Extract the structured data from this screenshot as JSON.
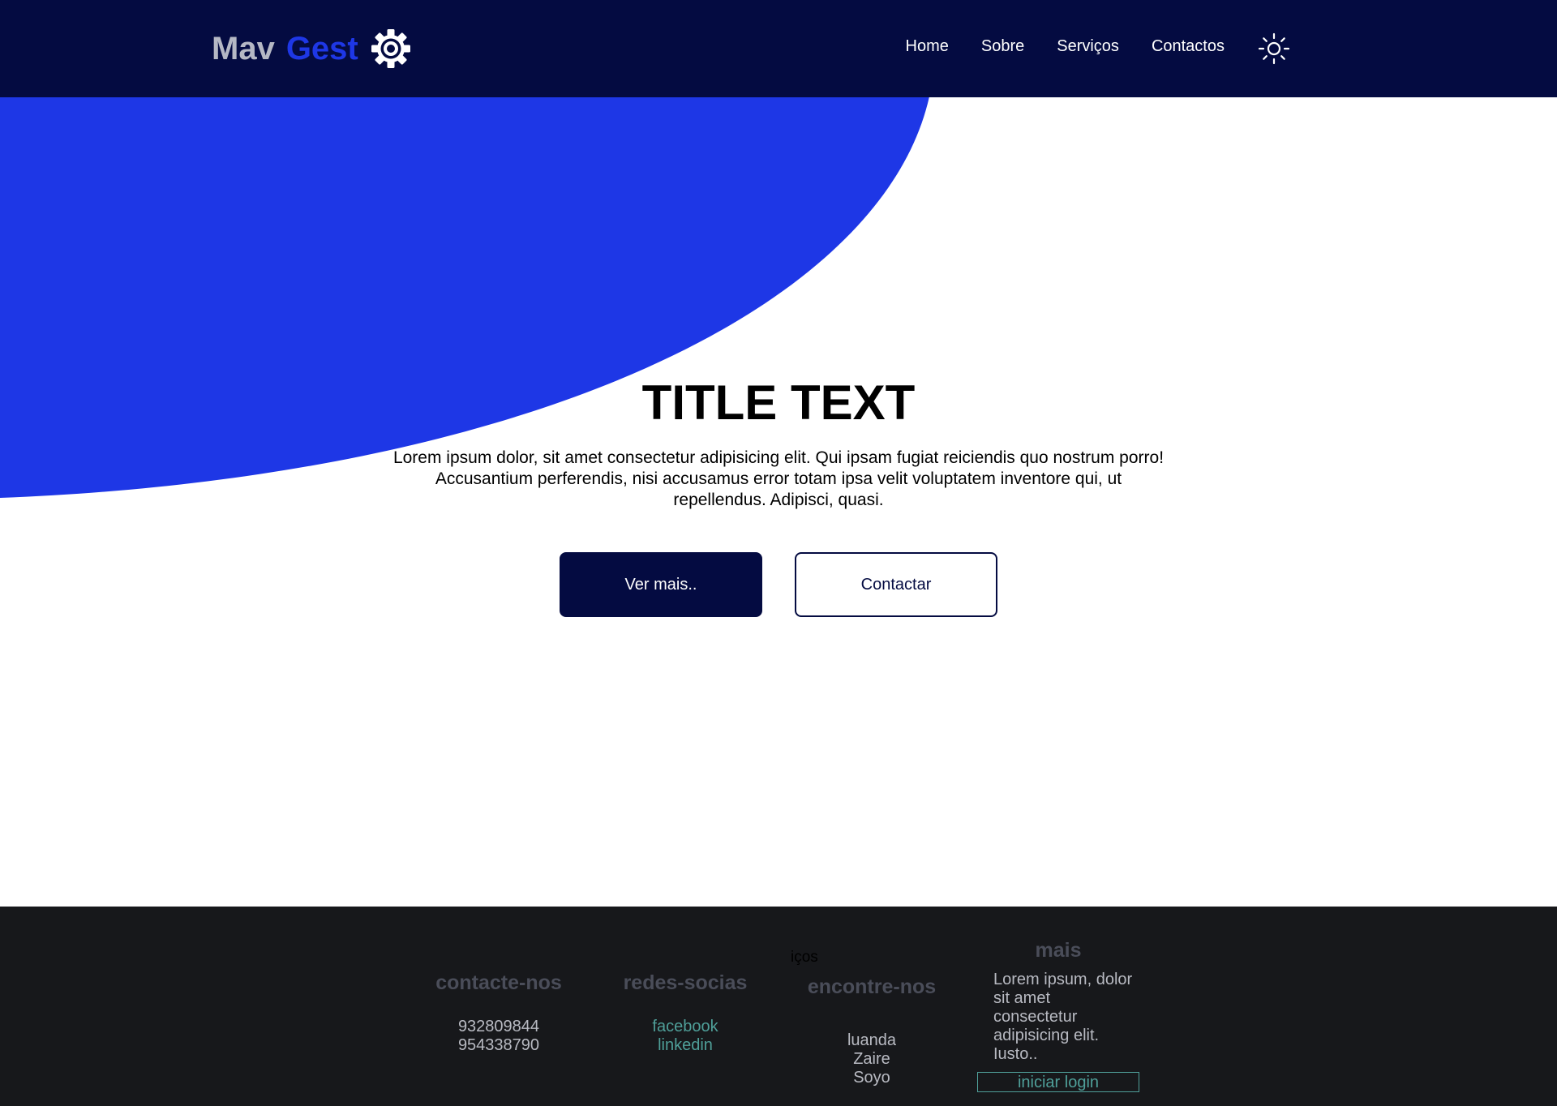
{
  "brand": {
    "name_part1": "Mav",
    "name_part2": "Gest",
    "icon": "gear-icon"
  },
  "nav": {
    "items": [
      {
        "label": "Home"
      },
      {
        "label": "Sobre"
      },
      {
        "label": "Serviços"
      },
      {
        "label": "Contactos"
      }
    ],
    "theme_toggle_icon": "sun-icon"
  },
  "hero": {
    "title": "TITLE TEXT",
    "text": "Lorem ipsum dolor, sit amet consectetur adipisicing elit. Qui ipsam fugiat reiciendis quo nostrum porro! Accusantium perferendis, nisi accusamus error totam ipsa velit voluptatem inventore qui, ut repellendus. Adipisci, quasi.",
    "primary_button": "Ver mais..",
    "secondary_button": "Contactar"
  },
  "footer": {
    "stray_text": "iços",
    "contact": {
      "heading": "contacte-nos",
      "lines": [
        "932809844",
        "954338790"
      ]
    },
    "social": {
      "heading": "redes-socias",
      "links": [
        "facebook",
        "linkedin"
      ]
    },
    "location": {
      "heading": "encontre-nos",
      "lines": [
        "luanda",
        "Zaire",
        "Soyo"
      ]
    },
    "more": {
      "heading": "mais",
      "text": "Lorem ipsum, dolor sit amet consectetur adipisicing elit. Iusto..",
      "login_button": "iniciar login"
    }
  },
  "colors": {
    "navy": "#040b41",
    "accent_blue": "#1e37e6",
    "footer_bg": "#17181b",
    "footer_link": "#4f9f99"
  }
}
